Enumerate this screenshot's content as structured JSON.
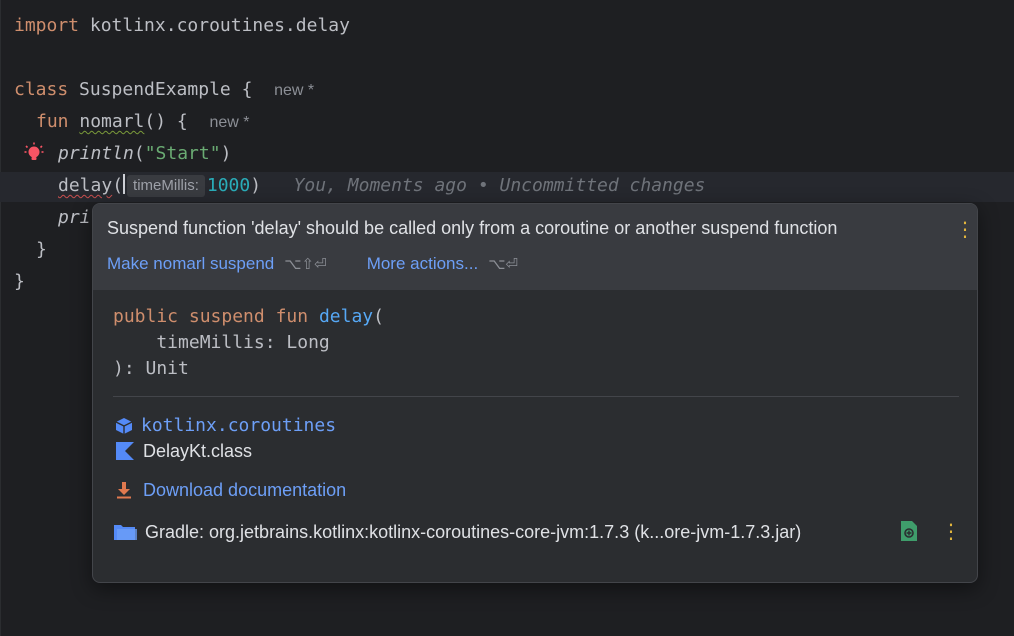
{
  "editor": {
    "lines": {
      "import_kw": "import",
      "import_path": " kotlinx.coroutines.delay",
      "class_kw": "class",
      "class_name": " SuspendExample {",
      "class_hint": "new",
      "class_hint_star": " *",
      "fun_kw": "fun",
      "fun_name": "nomarl",
      "fun_sig": "() {",
      "fun_hint": "new",
      "fun_hint_star": " *",
      "println_call": "println",
      "println_open": "(",
      "println_str": "\"Start\"",
      "println_close": ")",
      "delay_call": "delay",
      "delay_open": "(",
      "param_hint": "timeMillis:",
      "delay_arg": "1000",
      "delay_close": ")",
      "blame": "You, Moments ago • Uncommitted changes",
      "print_partial": "pri",
      "close_fun": "}",
      "close_class": "}"
    }
  },
  "popup": {
    "problem": "Suspend function 'delay' should be called only from a coroutine or another suspend function",
    "actions": [
      {
        "label": "Make nomarl suspend",
        "shortcut": "⌥⇧⏎"
      },
      {
        "label": "More actions...",
        "shortcut": "⌥⏎"
      }
    ],
    "signature": {
      "kw1": "public",
      "kw2": "suspend",
      "kw3": "fun",
      "fn": "delay",
      "open": "(",
      "param": "    timeMillis: Long",
      "close": "): Unit"
    },
    "package": "kotlinx.coroutines",
    "class_file": "DelayKt.class",
    "download": "Download documentation",
    "gradle": "Gradle: org.jetbrains.kotlinx:kotlinx-coroutines-core-jvm:1.7.3 (k...ore-jvm-1.7.3.jar)"
  },
  "colors": {
    "background": "#1e1f22",
    "keyword": "#cf8e6d",
    "string": "#6aab73",
    "number": "#2aacb8",
    "link": "#6d9ff7",
    "menu_dots": "#e2b53d"
  }
}
